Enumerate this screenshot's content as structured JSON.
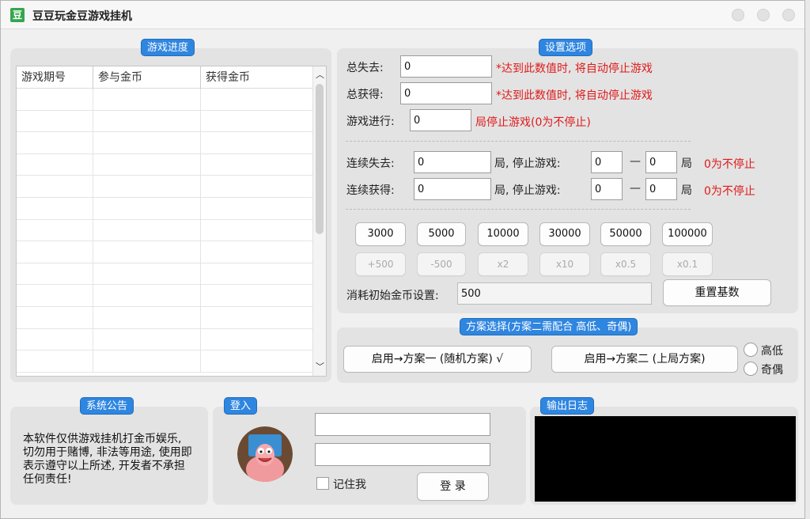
{
  "window": {
    "title": "豆豆玩金豆游戏挂机",
    "app_icon": "豆"
  },
  "progress": {
    "badge": "游戏进度",
    "columns": [
      "游戏期号",
      "参与金币",
      "获得金币"
    ],
    "rows": []
  },
  "settings": {
    "badge": "设置选项",
    "total_loss": {
      "label": "总失去:",
      "value": "0",
      "hint": "*达到此数值时, 将自动停止游戏"
    },
    "total_gain": {
      "label": "总获得:",
      "value": "0",
      "hint": "*达到此数值时, 将自动停止游戏"
    },
    "rounds": {
      "label": "游戏进行:",
      "value": "0",
      "hint": "局停止游戏(0为不停止)"
    },
    "consec_loss": {
      "label": "连续失去:",
      "value": "0",
      "mid": "局, 停止游戏:",
      "from": "0",
      "to": "0",
      "unit": "局",
      "note": "0为不停止"
    },
    "consec_gain": {
      "label": "连续获得:",
      "value": "0",
      "mid": "局, 停止游戏:",
      "from": "0",
      "to": "0",
      "unit": "局",
      "note": "0为不停止"
    },
    "dash_sep": "—",
    "amount_buttons": [
      "3000",
      "5000",
      "10000",
      "30000",
      "50000",
      "100000"
    ],
    "modifier_buttons": [
      "+500",
      "-500",
      "x2",
      "x10",
      "x0.5",
      "x0.1"
    ],
    "initial_coin": {
      "label": "消耗初始金币设置:",
      "value": "500"
    },
    "reset_button": "重置基数"
  },
  "scheme": {
    "badge": "方案选择(方案二需配合 高低、奇偶)",
    "plan1_button": "启用→方案一 (随机方案) √",
    "plan2_button": "启用→方案二 (上局方案)",
    "radio_high_low": "高低",
    "radio_odd_even": "奇偶"
  },
  "notice": {
    "badge": "系统公告",
    "text": "本软件仅供游戏挂机打金币娱乐, 切勿用于赌博, 非法等用途, 使用即表示遵守以上所述, 开发者不承担任何责任!"
  },
  "login": {
    "badge": "登入",
    "username": "",
    "password": "",
    "remember_label": "记住我",
    "login_button": "登 录"
  },
  "log": {
    "badge": "输出日志",
    "content": ""
  }
}
